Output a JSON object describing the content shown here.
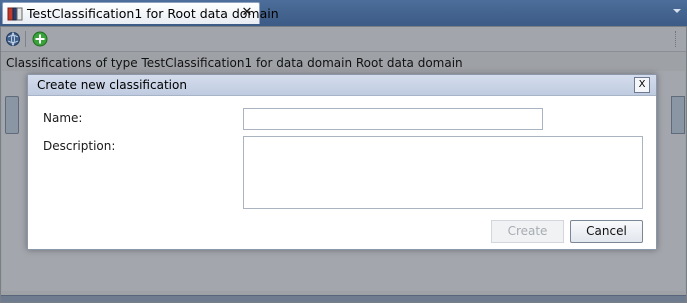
{
  "tab": {
    "title": "TestClassification1 for Root data domain",
    "close_glyph": "✕"
  },
  "toolbar": {
    "icons": [
      "globe-icon",
      "add-icon"
    ]
  },
  "panel": {
    "heading": "Classifications of type TestClassification1 for data domain Root data domain"
  },
  "dialog": {
    "title": "Create new classification",
    "close_label": "X",
    "name_label": "Name:",
    "name_value": "",
    "description_label": "Description:",
    "description_value": "",
    "create_label": "Create",
    "cancel_label": "Cancel"
  },
  "colors": {
    "tab_strip": "#3c5a86",
    "dialog_titlebar": "#c9d3e6",
    "add_icon": "#3aa23a"
  }
}
